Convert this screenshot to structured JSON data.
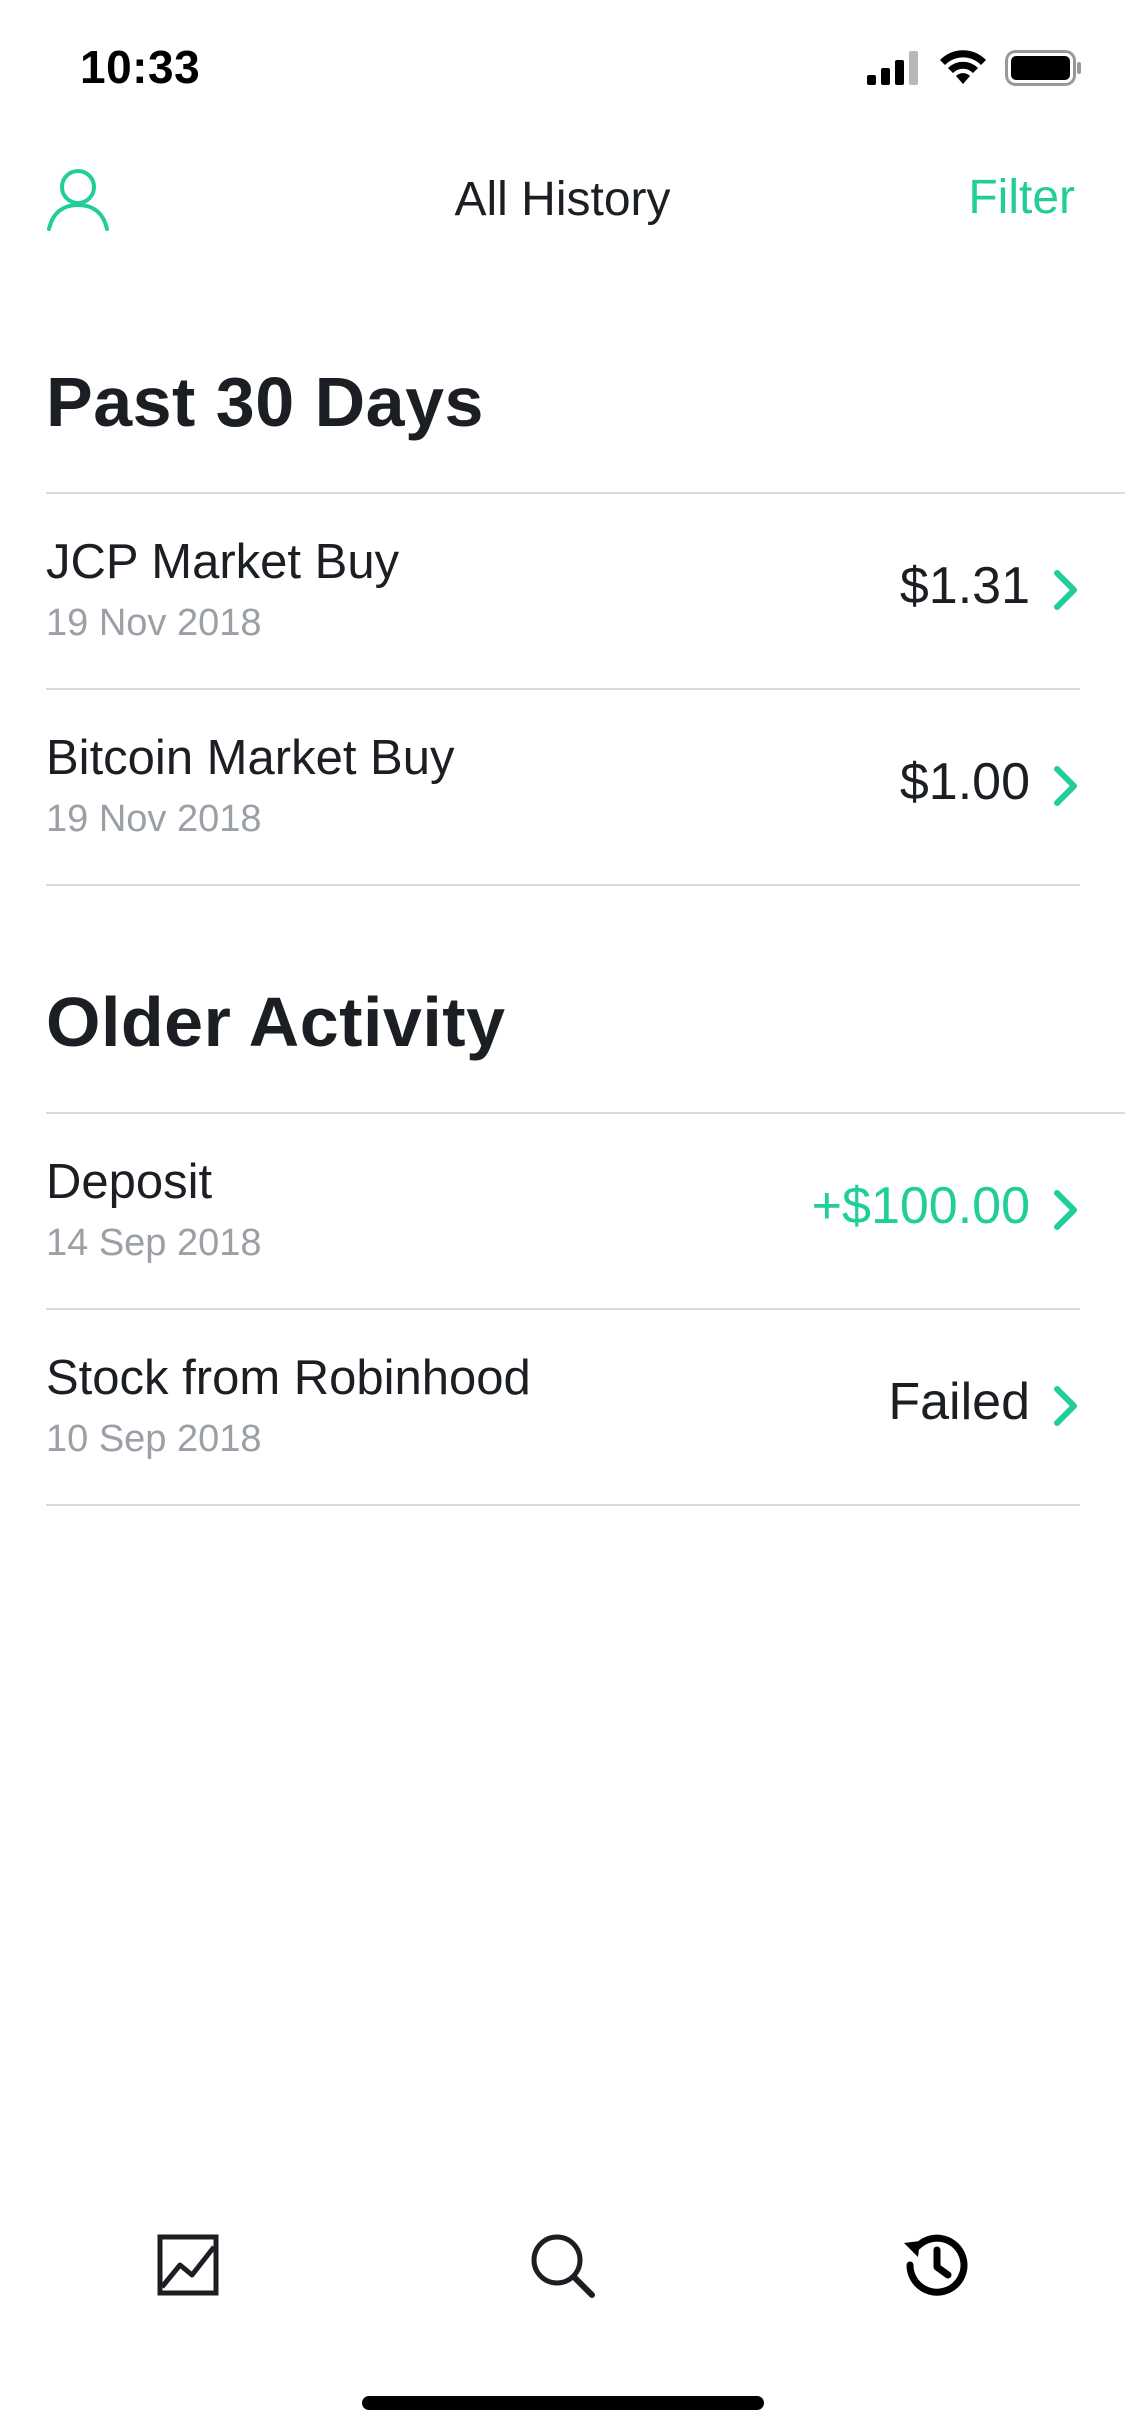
{
  "status_bar": {
    "time": "10:33",
    "icons": [
      "cellular-signal-icon",
      "wifi-icon",
      "battery-icon"
    ]
  },
  "nav": {
    "left_icon": "profile-icon",
    "title": "All History",
    "filter_label": "Filter"
  },
  "colors": {
    "accent": "#21ce99",
    "text": "#1b1f23",
    "secondary_text": "#9aa0a6",
    "divider": "#d9dcdf"
  },
  "sections": [
    {
      "title": "Past 30 Days",
      "items": [
        {
          "title": "JCP Market Buy",
          "date": "19 Nov 2018",
          "value": "$1.31",
          "value_style": "neutral"
        },
        {
          "title": "Bitcoin Market Buy",
          "date": "19 Nov 2018",
          "value": "$1.00",
          "value_style": "neutral"
        }
      ]
    },
    {
      "title": "Older Activity",
      "items": [
        {
          "title": "Deposit",
          "date": "14 Sep 2018",
          "value": "+$100.00",
          "value_style": "positive"
        },
        {
          "title": "Stock from Robinhood",
          "date": "10 Sep 2018",
          "value": "Failed",
          "value_style": "neutral"
        }
      ]
    }
  ],
  "tab_bar": {
    "tabs": [
      {
        "icon": "portfolio-chart-icon",
        "active": false
      },
      {
        "icon": "search-icon",
        "active": false
      },
      {
        "icon": "history-icon",
        "active": true
      }
    ]
  }
}
